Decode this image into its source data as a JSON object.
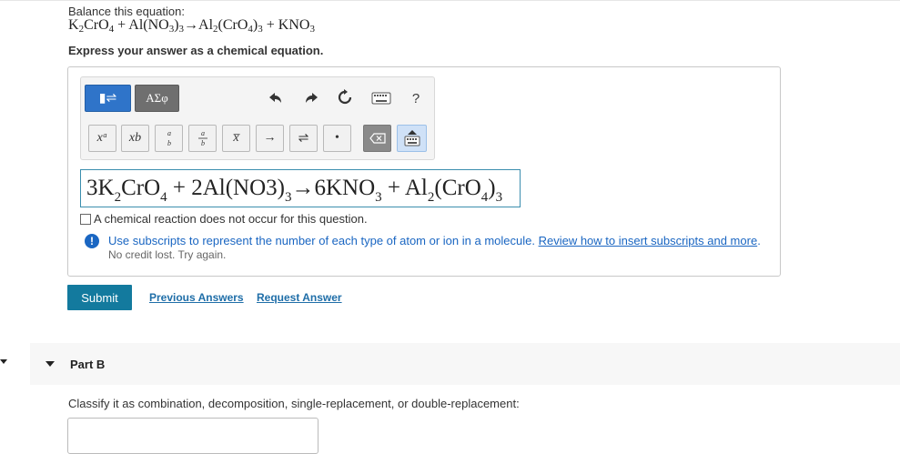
{
  "question": {
    "prompt": "Balance this equation:",
    "equation_parts": [
      {
        "t": "K",
        "sub": false
      },
      {
        "t": "2",
        "sub": true
      },
      {
        "t": "CrO",
        "sub": false
      },
      {
        "t": "4",
        "sub": true
      },
      {
        "t": " + Al(NO",
        "sub": false
      },
      {
        "t": "3",
        "sub": true
      },
      {
        "t": ")",
        "sub": false
      },
      {
        "t": "3",
        "sub": true
      },
      {
        "t": "→Al",
        "sub": false
      },
      {
        "t": "2",
        "sub": true
      },
      {
        "t": "(CrO",
        "sub": false
      },
      {
        "t": "4",
        "sub": true
      },
      {
        "t": ")",
        "sub": false
      },
      {
        "t": "3",
        "sub": true
      },
      {
        "t": " + KNO",
        "sub": false
      },
      {
        "t": "3",
        "sub": true
      }
    ],
    "instruction": "Express your answer as a chemical equation."
  },
  "toolbar": {
    "template_symbol": "▮⇌",
    "greek_label": "ΑΣφ",
    "superscript_label": "xᵃ",
    "subscript_label": "xb",
    "bar_label": "x̅",
    "arrow_label": "→",
    "equilibrium_label": "⇌",
    "dot_label": "•",
    "help_label": "?"
  },
  "answer_parts": [
    {
      "t": "3K",
      "sub": false
    },
    {
      "t": "2",
      "sub": true
    },
    {
      "t": "CrO",
      "sub": false
    },
    {
      "t": "4",
      "sub": true
    },
    {
      "t": " + 2Al(NO3)",
      "sub": false
    },
    {
      "t": "3",
      "sub": true
    },
    {
      "t": "→6KNO",
      "sub": false
    },
    {
      "t": "3",
      "sub": true
    },
    {
      "t": " + Al",
      "sub": false
    },
    {
      "t": "2",
      "sub": true
    },
    {
      "t": "(CrO",
      "sub": false
    },
    {
      "t": "4",
      "sub": true
    },
    {
      "t": ")",
      "sub": false
    },
    {
      "t": "3",
      "sub": true
    }
  ],
  "no_reaction_label": "A chemical reaction does not occur for this question.",
  "feedback": {
    "message": "Use subscripts to represent the number of each type of atom or ion in a molecule. ",
    "link": "Review how to insert subscripts and more",
    "end": ".",
    "sub": "No credit lost. Try again."
  },
  "actions": {
    "submit": "Submit",
    "previous": "Previous Answers",
    "request": "Request Answer"
  },
  "part_b": {
    "label": "Part B",
    "prompt": "Classify it as combination, decomposition, single-replacement, or double-replacement:"
  },
  "colors": {
    "accent": "#137a9e",
    "link": "#1f6ea8",
    "info": "#1a66c2",
    "input_border": "#3b8eae"
  }
}
